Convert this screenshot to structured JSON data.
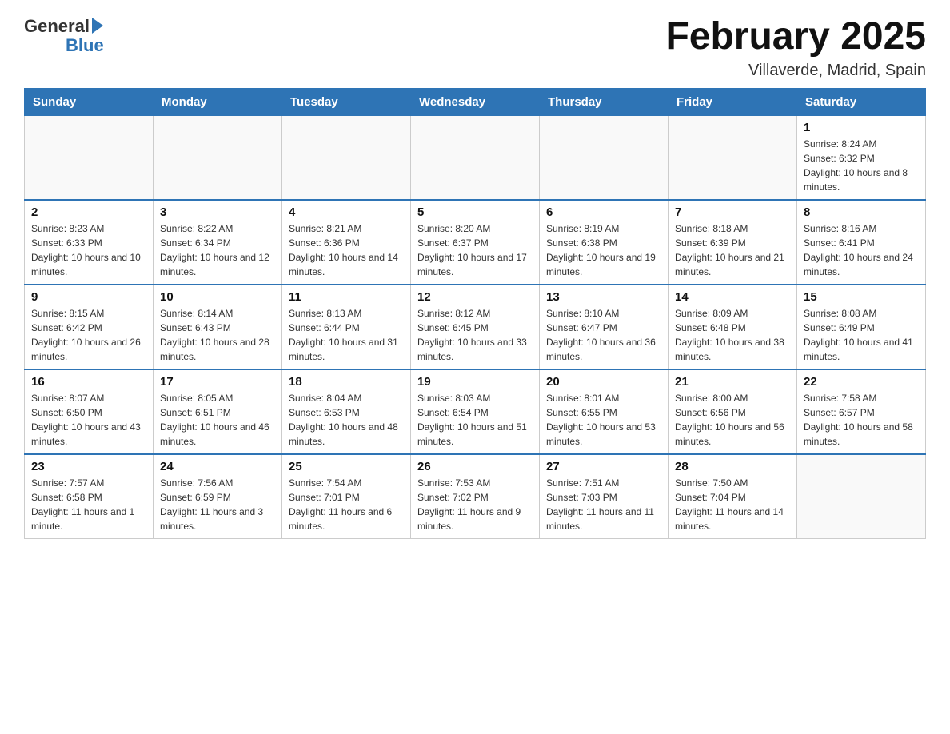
{
  "header": {
    "logo_general": "General",
    "logo_blue": "Blue",
    "calendar_title": "February 2025",
    "calendar_subtitle": "Villaverde, Madrid, Spain"
  },
  "weekdays": [
    "Sunday",
    "Monday",
    "Tuesday",
    "Wednesday",
    "Thursday",
    "Friday",
    "Saturday"
  ],
  "weeks": [
    [
      {
        "day": "",
        "sunrise": "",
        "sunset": "",
        "daylight": ""
      },
      {
        "day": "",
        "sunrise": "",
        "sunset": "",
        "daylight": ""
      },
      {
        "day": "",
        "sunrise": "",
        "sunset": "",
        "daylight": ""
      },
      {
        "day": "",
        "sunrise": "",
        "sunset": "",
        "daylight": ""
      },
      {
        "day": "",
        "sunrise": "",
        "sunset": "",
        "daylight": ""
      },
      {
        "day": "",
        "sunrise": "",
        "sunset": "",
        "daylight": ""
      },
      {
        "day": "1",
        "sunrise": "Sunrise: 8:24 AM",
        "sunset": "Sunset: 6:32 PM",
        "daylight": "Daylight: 10 hours and 8 minutes."
      }
    ],
    [
      {
        "day": "2",
        "sunrise": "Sunrise: 8:23 AM",
        "sunset": "Sunset: 6:33 PM",
        "daylight": "Daylight: 10 hours and 10 minutes."
      },
      {
        "day": "3",
        "sunrise": "Sunrise: 8:22 AM",
        "sunset": "Sunset: 6:34 PM",
        "daylight": "Daylight: 10 hours and 12 minutes."
      },
      {
        "day": "4",
        "sunrise": "Sunrise: 8:21 AM",
        "sunset": "Sunset: 6:36 PM",
        "daylight": "Daylight: 10 hours and 14 minutes."
      },
      {
        "day": "5",
        "sunrise": "Sunrise: 8:20 AM",
        "sunset": "Sunset: 6:37 PM",
        "daylight": "Daylight: 10 hours and 17 minutes."
      },
      {
        "day": "6",
        "sunrise": "Sunrise: 8:19 AM",
        "sunset": "Sunset: 6:38 PM",
        "daylight": "Daylight: 10 hours and 19 minutes."
      },
      {
        "day": "7",
        "sunrise": "Sunrise: 8:18 AM",
        "sunset": "Sunset: 6:39 PM",
        "daylight": "Daylight: 10 hours and 21 minutes."
      },
      {
        "day": "8",
        "sunrise": "Sunrise: 8:16 AM",
        "sunset": "Sunset: 6:41 PM",
        "daylight": "Daylight: 10 hours and 24 minutes."
      }
    ],
    [
      {
        "day": "9",
        "sunrise": "Sunrise: 8:15 AM",
        "sunset": "Sunset: 6:42 PM",
        "daylight": "Daylight: 10 hours and 26 minutes."
      },
      {
        "day": "10",
        "sunrise": "Sunrise: 8:14 AM",
        "sunset": "Sunset: 6:43 PM",
        "daylight": "Daylight: 10 hours and 28 minutes."
      },
      {
        "day": "11",
        "sunrise": "Sunrise: 8:13 AM",
        "sunset": "Sunset: 6:44 PM",
        "daylight": "Daylight: 10 hours and 31 minutes."
      },
      {
        "day": "12",
        "sunrise": "Sunrise: 8:12 AM",
        "sunset": "Sunset: 6:45 PM",
        "daylight": "Daylight: 10 hours and 33 minutes."
      },
      {
        "day": "13",
        "sunrise": "Sunrise: 8:10 AM",
        "sunset": "Sunset: 6:47 PM",
        "daylight": "Daylight: 10 hours and 36 minutes."
      },
      {
        "day": "14",
        "sunrise": "Sunrise: 8:09 AM",
        "sunset": "Sunset: 6:48 PM",
        "daylight": "Daylight: 10 hours and 38 minutes."
      },
      {
        "day": "15",
        "sunrise": "Sunrise: 8:08 AM",
        "sunset": "Sunset: 6:49 PM",
        "daylight": "Daylight: 10 hours and 41 minutes."
      }
    ],
    [
      {
        "day": "16",
        "sunrise": "Sunrise: 8:07 AM",
        "sunset": "Sunset: 6:50 PM",
        "daylight": "Daylight: 10 hours and 43 minutes."
      },
      {
        "day": "17",
        "sunrise": "Sunrise: 8:05 AM",
        "sunset": "Sunset: 6:51 PM",
        "daylight": "Daylight: 10 hours and 46 minutes."
      },
      {
        "day": "18",
        "sunrise": "Sunrise: 8:04 AM",
        "sunset": "Sunset: 6:53 PM",
        "daylight": "Daylight: 10 hours and 48 minutes."
      },
      {
        "day": "19",
        "sunrise": "Sunrise: 8:03 AM",
        "sunset": "Sunset: 6:54 PM",
        "daylight": "Daylight: 10 hours and 51 minutes."
      },
      {
        "day": "20",
        "sunrise": "Sunrise: 8:01 AM",
        "sunset": "Sunset: 6:55 PM",
        "daylight": "Daylight: 10 hours and 53 minutes."
      },
      {
        "day": "21",
        "sunrise": "Sunrise: 8:00 AM",
        "sunset": "Sunset: 6:56 PM",
        "daylight": "Daylight: 10 hours and 56 minutes."
      },
      {
        "day": "22",
        "sunrise": "Sunrise: 7:58 AM",
        "sunset": "Sunset: 6:57 PM",
        "daylight": "Daylight: 10 hours and 58 minutes."
      }
    ],
    [
      {
        "day": "23",
        "sunrise": "Sunrise: 7:57 AM",
        "sunset": "Sunset: 6:58 PM",
        "daylight": "Daylight: 11 hours and 1 minute."
      },
      {
        "day": "24",
        "sunrise": "Sunrise: 7:56 AM",
        "sunset": "Sunset: 6:59 PM",
        "daylight": "Daylight: 11 hours and 3 minutes."
      },
      {
        "day": "25",
        "sunrise": "Sunrise: 7:54 AM",
        "sunset": "Sunset: 7:01 PM",
        "daylight": "Daylight: 11 hours and 6 minutes."
      },
      {
        "day": "26",
        "sunrise": "Sunrise: 7:53 AM",
        "sunset": "Sunset: 7:02 PM",
        "daylight": "Daylight: 11 hours and 9 minutes."
      },
      {
        "day": "27",
        "sunrise": "Sunrise: 7:51 AM",
        "sunset": "Sunset: 7:03 PM",
        "daylight": "Daylight: 11 hours and 11 minutes."
      },
      {
        "day": "28",
        "sunrise": "Sunrise: 7:50 AM",
        "sunset": "Sunset: 7:04 PM",
        "daylight": "Daylight: 11 hours and 14 minutes."
      },
      {
        "day": "",
        "sunrise": "",
        "sunset": "",
        "daylight": ""
      }
    ]
  ]
}
